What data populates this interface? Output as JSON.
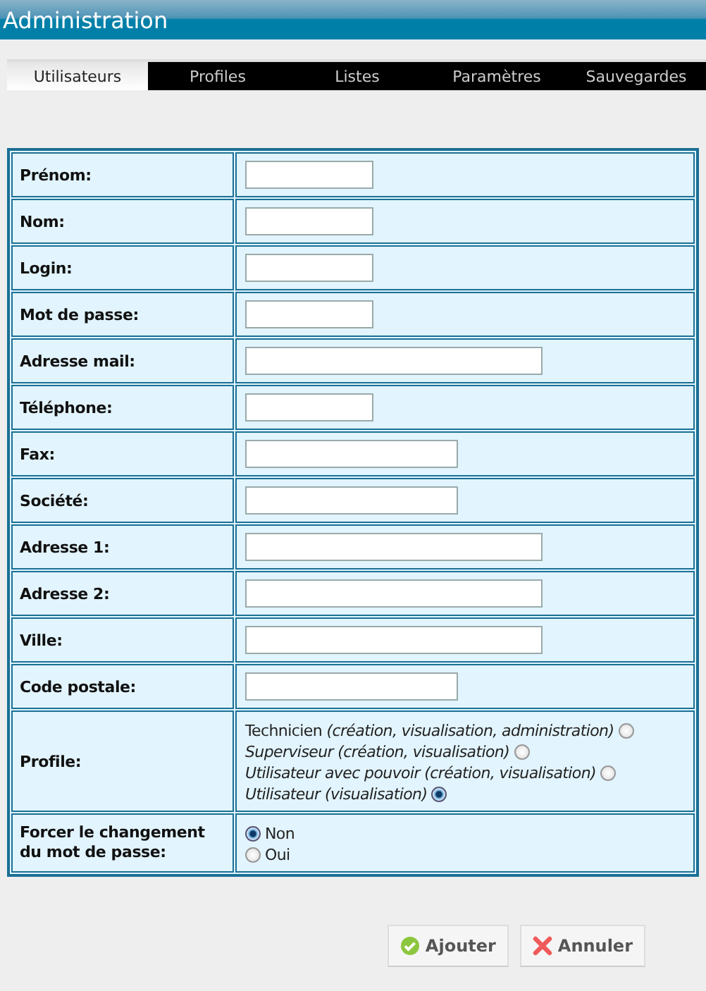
{
  "window": {
    "title": "Administration"
  },
  "tabs": [
    {
      "label": "Utilisateurs",
      "selected": true
    },
    {
      "label": "Profiles",
      "selected": false
    },
    {
      "label": "Listes",
      "selected": false
    },
    {
      "label": "Paramètres",
      "selected": false
    },
    {
      "label": "Sauvegardes",
      "selected": false
    }
  ],
  "form": {
    "fields": [
      {
        "label": "Prénom:",
        "kind": "short"
      },
      {
        "label": "Nom:",
        "kind": "short"
      },
      {
        "label": "Login:",
        "kind": "short"
      },
      {
        "label": "Mot de passe:",
        "kind": "short"
      },
      {
        "label": "Adresse mail:",
        "kind": "long"
      },
      {
        "label": "Téléphone:",
        "kind": "short"
      },
      {
        "label": "Fax:",
        "kind": "medium"
      },
      {
        "label": "Société:",
        "kind": "medium"
      },
      {
        "label": "Adresse 1:",
        "kind": "long"
      },
      {
        "label": "Adresse 2:",
        "kind": "long"
      },
      {
        "label": "Ville:",
        "kind": "long"
      },
      {
        "label": "Code postale:",
        "kind": "medium"
      }
    ],
    "profile": {
      "label": "Profile:",
      "options": [
        {
          "text": "Technicien *(création, visualisation, administration)*",
          "italic": false,
          "selected": false
        },
        {
          "text": "Superviseur (création, visualisation)",
          "italic": true,
          "selected": false
        },
        {
          "text": "Utilisateur avec pouvoir (création, visualisation)",
          "italic": true,
          "selected": false
        },
        {
          "text": "Utilisateur (visualisation)",
          "italic": true,
          "selected": true
        }
      ]
    },
    "force_change": {
      "label": "Forcer le changement du mot de passe:",
      "options": [
        {
          "text": "Non",
          "selected": true
        },
        {
          "text": "Oui",
          "selected": false
        }
      ]
    }
  },
  "buttons": [
    {
      "label": "Ajouter",
      "kind": "add"
    },
    {
      "label": "Annuler",
      "kind": "cancel"
    }
  ]
}
